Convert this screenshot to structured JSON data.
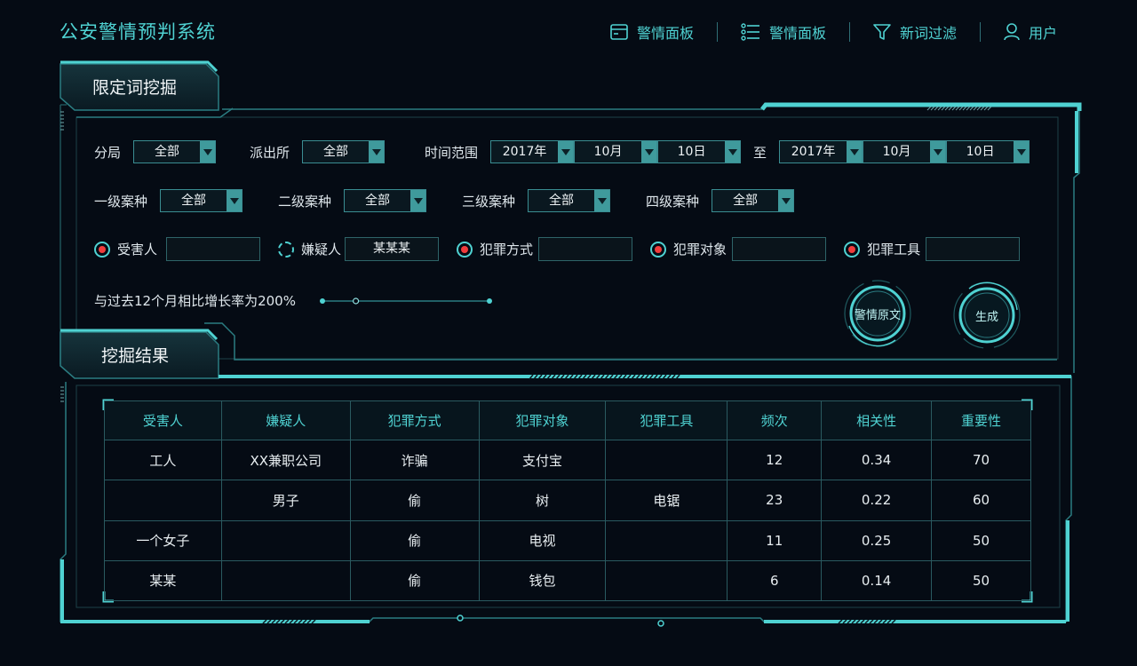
{
  "app": {
    "title": "公安警情预判系统"
  },
  "nav": [
    {
      "label": "警情面板",
      "icon": "window-icon"
    },
    {
      "label": "警情面板",
      "icon": "list-icon"
    },
    {
      "label": "新词过滤",
      "icon": "filter-icon"
    },
    {
      "label": "用户",
      "icon": "user-icon"
    }
  ],
  "filter_section": {
    "title": "限定词挖掘"
  },
  "results_section": {
    "title": "挖掘结果"
  },
  "filters": {
    "branch": {
      "label": "分局",
      "value": "全部"
    },
    "station": {
      "label": "派出所",
      "value": "全部"
    },
    "time_range": {
      "label": "时间范围",
      "to_label": "至",
      "start": {
        "year": "2017年",
        "month": "10月",
        "day": "10日"
      },
      "end": {
        "year": "2017年",
        "month": "10月",
        "day": "10日"
      }
    },
    "case_types": [
      {
        "label": "一级案种",
        "value": "全部"
      },
      {
        "label": "二级案种",
        "value": "全部"
      },
      {
        "label": "三级案种",
        "value": "全部"
      },
      {
        "label": "四级案种",
        "value": "全部"
      }
    ],
    "keywords": [
      {
        "label": "受害人",
        "value": "",
        "checked": true
      },
      {
        "label": "嫌疑人",
        "value": "某某某",
        "checked": false
      },
      {
        "label": "犯罪方式",
        "value": "",
        "checked": true
      },
      {
        "label": "犯罪对象",
        "value": "",
        "checked": true
      },
      {
        "label": "犯罪工具",
        "value": "",
        "checked": true
      }
    ],
    "growth": {
      "text": "与过去12个月相比增长率为200%",
      "slider_value": 0.2
    }
  },
  "buttons": {
    "original_text": "警情原文",
    "generate": "生成"
  },
  "table": {
    "columns": [
      "受害人",
      "嫌疑人",
      "犯罪方式",
      "犯罪对象",
      "犯罪工具",
      "频次",
      "相关性",
      "重要性"
    ],
    "rows": [
      [
        "工人",
        "XX兼职公司",
        "诈骗",
        "支付宝",
        "",
        "12",
        "0.34",
        "70"
      ],
      [
        "",
        "男子",
        "偷",
        "树",
        "电锯",
        "23",
        "0.22",
        "60"
      ],
      [
        "一个女子",
        "",
        "偷",
        "电视",
        "",
        "11",
        "0.25",
        "50"
      ],
      [
        "某某",
        "",
        "偷",
        "钱包",
        "",
        "6",
        "0.14",
        "50"
      ]
    ]
  },
  "colors": {
    "accent": "#4fd2d2",
    "background": "#050b14",
    "radio_dot": "#ef3c3c"
  }
}
